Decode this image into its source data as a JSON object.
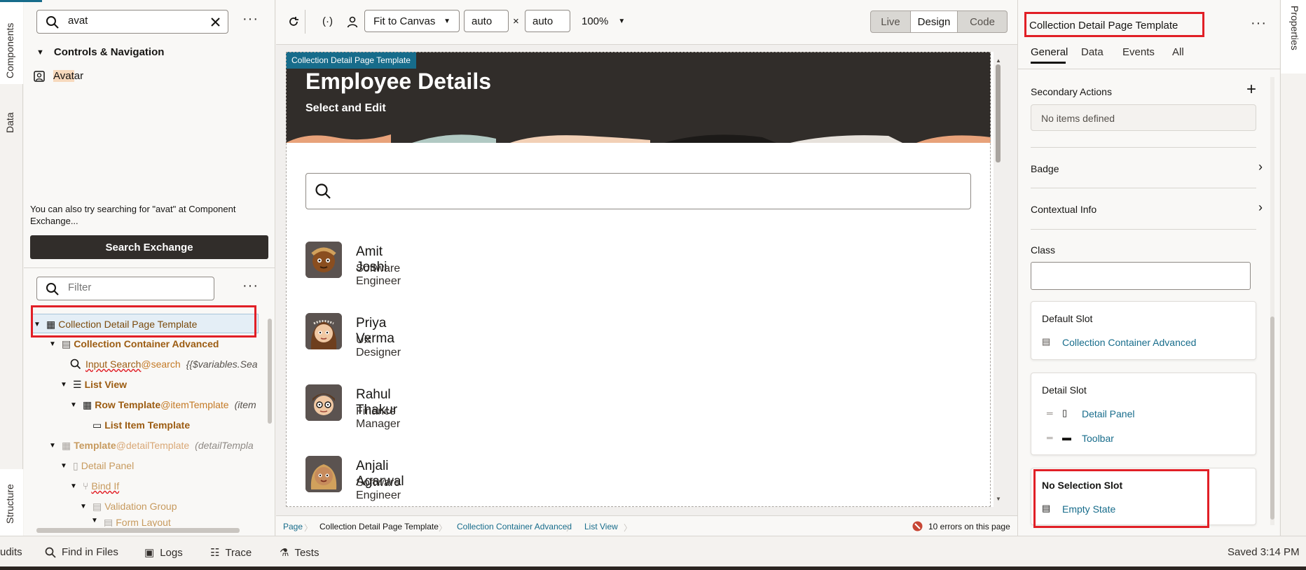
{
  "vertical_tabs": {
    "components": "Components",
    "data": "Data",
    "structure": "Structure",
    "properties": "Properties"
  },
  "components_panel": {
    "search_value": "avat",
    "group_label": "Controls & Navigation",
    "result_label": "Avatar",
    "result_highlight": "Avat",
    "result_rest": "ar",
    "exchange_hint": "You can also try searching for \"avat\" at Component Exchange...",
    "search_exchange_button": "Search Exchange"
  },
  "structure_panel": {
    "filter_placeholder": "Filter",
    "tree": [
      {
        "label": "Collection Detail Page Template",
        "extra": "",
        "slot": ""
      },
      {
        "label": "Collection Container Advanced",
        "extra": "",
        "slot": ""
      },
      {
        "label": "Input Search",
        "slot": "@search",
        "extra": "{{$variables.Sea"
      },
      {
        "label": "List View",
        "slot": "",
        "extra": ""
      },
      {
        "label": "Row Template",
        "slot": "@itemTemplate",
        "extra": "(item"
      },
      {
        "label": "List Item Template",
        "slot": "",
        "extra": ""
      },
      {
        "label": "Template",
        "slot": "@detailTemplate",
        "extra": "(detailTempla"
      },
      {
        "label": "Detail Panel",
        "slot": "",
        "extra": ""
      },
      {
        "label": "Bind If",
        "slot": "",
        "extra": ""
      },
      {
        "label": "Validation Group",
        "slot": "",
        "extra": ""
      },
      {
        "label": "Form Layout",
        "slot": "",
        "extra": ""
      }
    ]
  },
  "toolbar": {
    "fit_label": "Fit to Canvas",
    "width_value": "auto",
    "height_value": "auto",
    "times": "×",
    "zoom": "100%",
    "live": "Live",
    "design": "Design",
    "code": "Code"
  },
  "canvas": {
    "badge": "Collection Detail Page Template",
    "title": "Employee Details",
    "subtitle": "Select and Edit",
    "employees": [
      {
        "name": "Amit Joshi",
        "role": "Software Engineer"
      },
      {
        "name": "Priya Verma",
        "role": "UX Designer"
      },
      {
        "name": "Rahul Thakur",
        "role": "Finance Manager"
      },
      {
        "name": "Anjali Agarwal",
        "role": "Software Engineer"
      }
    ]
  },
  "breadcrumb": {
    "items": [
      "Page",
      "Collection Detail Page Template",
      "Collection Container Advanced",
      "List View"
    ],
    "errors": "10 errors on this page"
  },
  "properties": {
    "component_title": "Collection Detail Page Template",
    "tabs": [
      "General",
      "Data",
      "Events",
      "All"
    ],
    "secondary_actions": "Secondary Actions",
    "no_items": "No items defined",
    "badge": "Badge",
    "contextual_info": "Contextual Info",
    "class_label": "Class",
    "default_slot": "Default Slot",
    "default_slot_item": "Collection Container Advanced",
    "detail_slot": "Detail Slot",
    "detail_slot_items": [
      "Detail Panel",
      "Toolbar"
    ],
    "no_selection_slot": "No Selection Slot",
    "no_selection_item": "Empty State"
  },
  "bottom_bar": {
    "audits": "udits",
    "find": "Find in Files",
    "logs": "Logs",
    "trace": "Trace",
    "tests": "Tests",
    "saved": "Saved 3:14 PM"
  },
  "colors": {
    "accent": "#176c8b",
    "header_bg": "#312d2a",
    "highlight_box": "#e11f26",
    "tree_brown": "#9c5c12"
  }
}
